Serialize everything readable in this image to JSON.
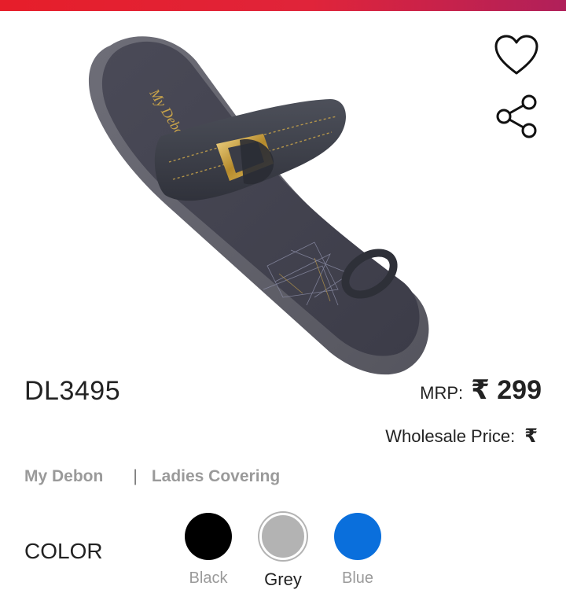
{
  "product": {
    "code": "DL3495",
    "mrp_label": "MRP:",
    "mrp_value": "₹ 299",
    "wholesale_label": "Wholesale Price:",
    "wholesale_value": "₹",
    "brand": "My Debon",
    "separator": "|",
    "category": "Ladies Covering",
    "image_alt": "Grey ladies toe-ring slipper with gold buckle"
  },
  "icons": {
    "wishlist": "heart-outline-icon",
    "share": "share-icon"
  },
  "colors": {
    "label": "COLOR",
    "options": [
      {
        "name": "Black",
        "hex": "#000000",
        "selected": false
      },
      {
        "name": "Grey",
        "hex": "#b3b3b3",
        "selected": true
      },
      {
        "name": "Blue",
        "hex": "#0a6fdc",
        "selected": false
      }
    ]
  },
  "theme": {
    "accent": "#e61e2a"
  }
}
